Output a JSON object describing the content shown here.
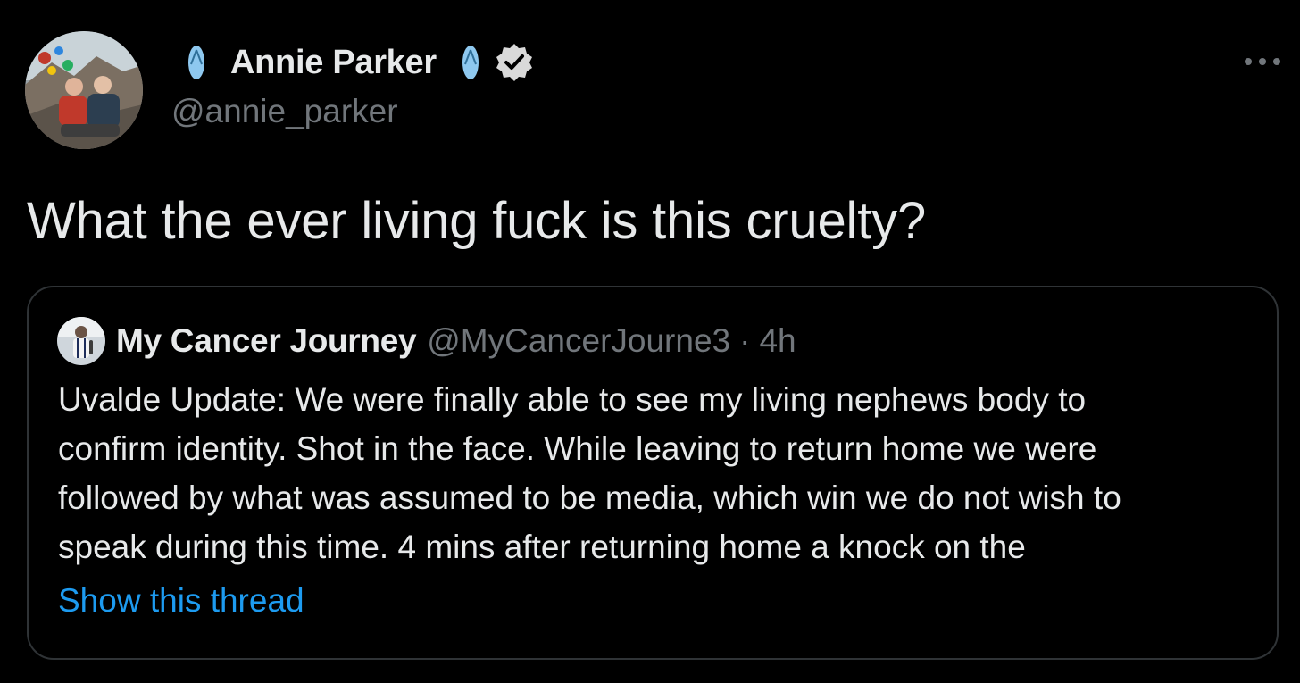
{
  "tweet": {
    "author": {
      "display_name": "Annie Parker",
      "handle": "@annie_parker",
      "verified": true,
      "name_emoji": "flip-flop-icon"
    },
    "text": "What the ever living fuck is this cruelty?",
    "more_icon": "more-horizontal-icon"
  },
  "quoted_tweet": {
    "display_name": "My Cancer Journey",
    "handle": "@MyCancerJourne3",
    "separator": "·",
    "time": "4h",
    "lines": [
      "Uvalde Update: We were finally able to see my living nephews body to",
      "confirm identity. Shot in the face. While leaving to return home we were",
      "followed by what was assumed to be media, which win we do not wish to",
      "speak during this time. 4 mins after returning home a knock on the"
    ],
    "show_thread": "Show this thread"
  },
  "colors": {
    "background": "#000000",
    "text_primary": "#e7e9ea",
    "text_secondary": "#71767b",
    "link": "#1d9bf0",
    "border": "#2f3336",
    "flipflop": "#8ec8ef"
  }
}
